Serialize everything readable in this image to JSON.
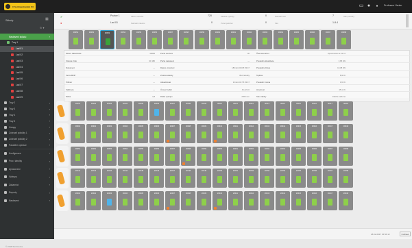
{
  "app": {
    "logo_text": "C Sortimentmodul 5.0",
    "user": "Professor Vanier"
  },
  "sidebar": {
    "title": "Sklady",
    "items": [
      {
        "label": "Nastavení skladu",
        "state": "active",
        "icon": "#4aa14a"
      },
      {
        "label": "Tray 1",
        "state": "sub",
        "icon": "#6fc06f"
      },
      {
        "label": "Lad 01",
        "state": "selected",
        "icon": "#e04040"
      },
      {
        "label": "Lad 02",
        "state": "sub2",
        "icon": "#e04040"
      },
      {
        "label": "Lad 03",
        "state": "sub2",
        "icon": "#e04040"
      },
      {
        "label": "Lad 04",
        "state": "sub2",
        "icon": "#e04040"
      },
      {
        "label": "Lad 05",
        "state": "sub2",
        "icon": "#e04040"
      },
      {
        "label": "Lad 06",
        "state": "sub2",
        "icon": "#e04040"
      },
      {
        "label": "Lad 07",
        "state": "sub2",
        "icon": "#e04040"
      },
      {
        "label": "Lad 08",
        "state": "sub2",
        "icon": "#e04040"
      },
      {
        "label": "Lad 09",
        "state": "sub2",
        "icon": "#e04040"
      },
      {
        "label": "Tray 2",
        "state": "plain",
        "icon": "#bbb"
      },
      {
        "label": "Tray 3",
        "state": "plain",
        "icon": "#bbb"
      },
      {
        "label": "Tray 4",
        "state": "plain",
        "icon": "#bbb"
      },
      {
        "label": "Tray 5",
        "state": "plain",
        "icon": "#bbb"
      },
      {
        "label": "Vstupy",
        "state": "plain",
        "icon": "#bbb"
      },
      {
        "label": "Zobrazit položky 1",
        "state": "plain",
        "icon": "#bbb"
      },
      {
        "label": "Zobrazit položky 2",
        "state": "plain",
        "icon": "#bbb"
      },
      {
        "label": "Paralelní operace",
        "state": "plain",
        "icon": "#bbb"
      },
      {
        "label": "Konfigurace",
        "state": "section",
        "icon": "#bbb"
      },
      {
        "label": "Prac. tabulky",
        "state": "section",
        "icon": "#bbb"
      },
      {
        "label": "Zpracování",
        "state": "section",
        "icon": "#bbb"
      },
      {
        "label": "Výstupy",
        "state": "section",
        "icon": "#bbb"
      },
      {
        "label": "Zákazníci",
        "state": "section",
        "icon": "#bbb"
      },
      {
        "label": "Reporty",
        "state": "section",
        "icon": "#bbb"
      },
      {
        "label": "Nastavení",
        "state": "section",
        "icon": "#bbb"
      }
    ],
    "footer": "© 2018 Sortimenta"
  },
  "header": {
    "title1": "Pozice 1",
    "title2": "Lad 01",
    "col1_a": "Aktivní zásoba",
    "col1_b": "Nahradit zásobu",
    "num1": "720",
    "num2": "0",
    "col2_a": "Zadané výstupy",
    "col2_b": "Počet položek",
    "num3": "0",
    "num4": "0",
    "col3_a": "Nahradit slot",
    "col3_b": "Slot",
    "num5": "7",
    "num6": "1.8.4",
    "col4_a": "Stav položky"
  },
  "details": {
    "rows": [
      [
        "Název zákaznické",
        "33865",
        "Počet otevření",
        "30",
        "Čas dokončení",
        "Zpracovává se 21.11"
      ],
      [
        "Kódové číslo",
        "91 986",
        "Počet nastavení",
        "—",
        "Poslední aktualizace",
        "3,85 kW"
      ],
      [
        "Dokument",
        "—",
        "Datum vytvoření",
        "18.Feb.2016 8:33:47",
        "Poslední přístup",
        "10,38 kW"
      ],
      [
        "Verze MOP",
        "—",
        "Změna tabulky",
        "Bez tabulky",
        "Teplota",
        "8,90 K"
      ],
      [
        "Průměr",
        "—",
        "Aktualizovat",
        "3.Feb.2017 8:33:47",
        "Poslední změna",
        "3,63 K"
      ],
      [
        "Kalibrace",
        "—",
        "Úroveň nabití",
        "41,22 kU",
        "Hmotnost",
        "45,12 K"
      ],
      [
        "Délka",
        "3,8",
        "Délka výstupu",
        "2300 mm",
        "Stav zálohy",
        "Záloha uložena"
      ]
    ]
  },
  "rows": [
    {
      "slots": [
        "30051",
        "30052",
        "30053",
        "30054",
        "30055",
        "30056",
        "30057",
        "30058",
        "30059",
        "30060",
        "30061",
        "30062",
        "30063",
        "30064",
        "30065",
        "30066",
        "30067",
        "30068"
      ],
      "selected": 2,
      "blue": [],
      "warn": []
    },
    {
      "slots": [
        "30101",
        "30102",
        "30103",
        "30104",
        "30105",
        "30106",
        "30107",
        "30108",
        "30109",
        "30110",
        "30111",
        "30112",
        "30113",
        "30114",
        "30115",
        "30116",
        "30117",
        "30118"
      ],
      "selected": -1,
      "blue": [
        5
      ],
      "warn": []
    },
    {
      "slots": [
        "30301",
        "30302",
        "30303",
        "30304",
        "30305",
        "30306",
        "30307",
        "30308",
        "30309",
        "30310",
        "30311",
        "30312",
        "30313",
        "30314",
        "30315",
        "30316",
        "30317",
        "30318"
      ],
      "selected": -1,
      "blue": [],
      "warn": [
        6,
        9
      ]
    },
    {
      "slots": [
        "30051",
        "30052",
        "30053",
        "30054",
        "30055",
        "30056",
        "30057",
        "30058",
        "30059",
        "30060",
        "30061",
        "30062",
        "30063",
        "30064",
        "30065",
        "30066",
        "30067",
        "30068"
      ],
      "selected": -1,
      "blue": [],
      "warn": [
        7
      ]
    },
    {
      "slots": [
        "20741",
        "20742",
        "20743",
        "20744",
        "20745",
        "20746",
        "20747",
        "20748",
        "20749",
        "20750",
        "20751",
        "20752",
        "20753",
        "20754",
        "20755",
        "20756",
        "20757",
        "20758"
      ],
      "selected": -1,
      "blue": [],
      "warn": []
    },
    {
      "slots": [
        "20401",
        "20402",
        "20403",
        "20404",
        "20405",
        "20406",
        "20407",
        "20408",
        "20409",
        "20410",
        "20411",
        "20412",
        "20413",
        "20414",
        "20415",
        "20416",
        "20417",
        "20418"
      ],
      "selected": -1,
      "blue": [
        2
      ],
      "warn": [
        6,
        9
      ]
    }
  ],
  "statusbar": {
    "datetime": "18.02.2017 15:56:12",
    "btn": "Odhlásit"
  }
}
